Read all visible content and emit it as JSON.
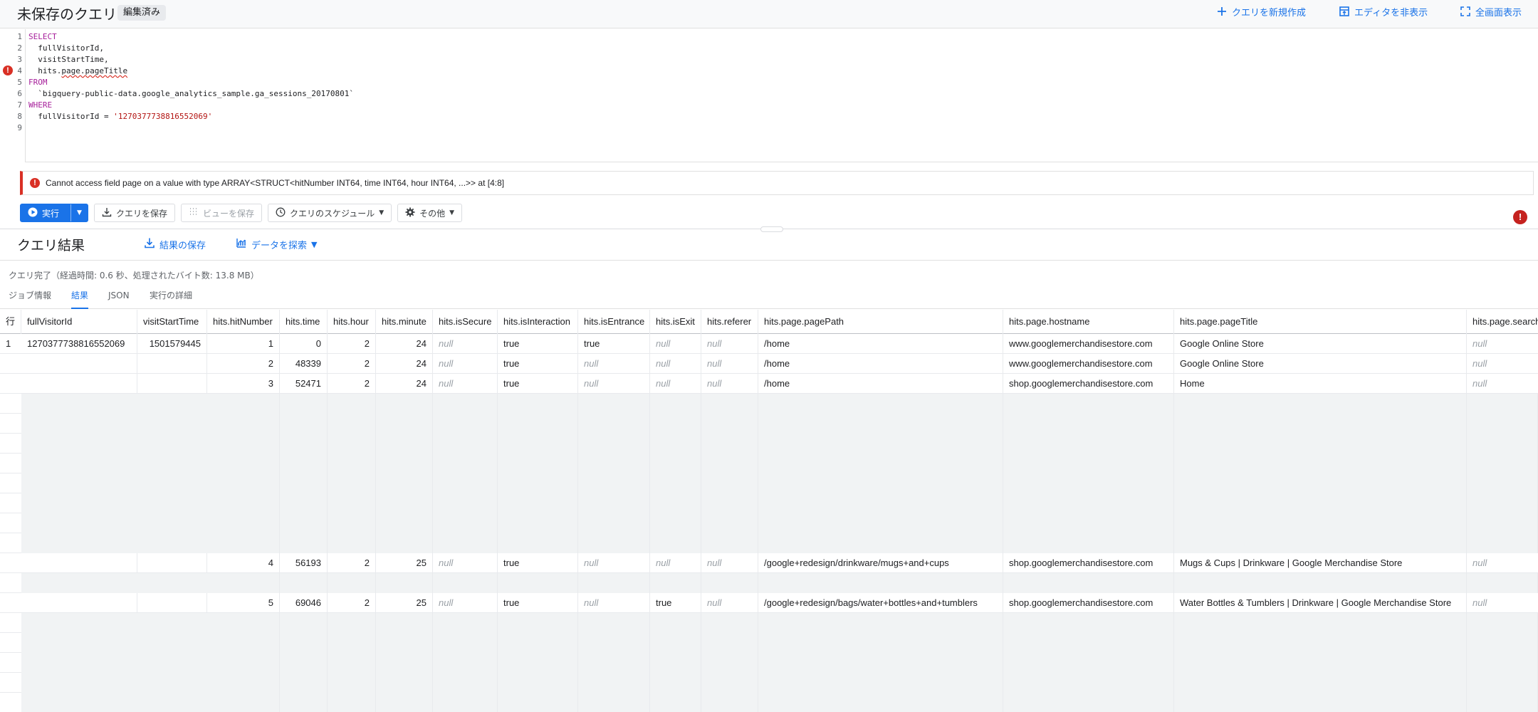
{
  "header": {
    "title": "未保存のクエリ",
    "badge": "編集済み",
    "actions": [
      "クエリを新規作成",
      "エディタを非表示",
      "全画面表示"
    ]
  },
  "editor": {
    "line_numbers": [
      "1",
      "2",
      "3",
      "4",
      "5",
      "6",
      "7",
      "8",
      "9"
    ],
    "lines": [
      {
        "kw": "SELECT",
        "rest": ""
      },
      {
        "kw": "",
        "rest": "  fullVisitorId,"
      },
      {
        "kw": "",
        "rest": "  visitStartTime,"
      },
      {
        "kw": "",
        "pre": "  hits.",
        "squiggle": "page.pageTitle"
      },
      {
        "kw": "FROM",
        "rest": ""
      },
      {
        "kw": "",
        "rest": "  `bigquery-public-data.google_analytics_sample.ga_sessions_20170801`"
      },
      {
        "kw": "WHERE",
        "rest": ""
      },
      {
        "kw": "",
        "pre": "  fullVisitorId = ",
        "str": "'1270377738816552069'"
      },
      {
        "kw": "",
        "rest": ""
      }
    ]
  },
  "error": {
    "message": "Cannot access field page on a value with type ARRAY<STRUCT<hitNumber INT64, time INT64, hour INT64, ...>> at [4:8]"
  },
  "toolbar": {
    "run": "実行",
    "save_query": "クエリを保存",
    "save_view": "ビューを保存",
    "schedule": "クエリのスケジュール",
    "more": "その他"
  },
  "results": {
    "title": "クエリ結果",
    "save_results": "結果の保存",
    "explore": "データを探索",
    "status": "クエリ完了（経過時間: 0.6 秒、処理されたバイト数: 13.8 MB）",
    "tabs": [
      "ジョブ情報",
      "結果",
      "JSON",
      "実行の詳細"
    ],
    "active_tab": "結果"
  },
  "table": {
    "columns": [
      "行",
      "fullVisitorId",
      "visitStartTime",
      "hits.hitNumber",
      "hits.time",
      "hits.hour",
      "hits.minute",
      "hits.isSecure",
      "hits.isInteraction",
      "hits.isEntrance",
      "hits.isExit",
      "hits.referer",
      "hits.page.pagePath",
      "hits.page.hostname",
      "hits.page.pageTitle",
      "hits.page.searchKeyword"
    ],
    "rows": [
      {
        "row": "1",
        "fullVisitorId": "1270377738816552069",
        "visitStartTime": "1501579445",
        "hitNumber": "1",
        "time": "0",
        "hour": "2",
        "minute": "24",
        "isSecure": "null",
        "isInteraction": "true",
        "isEntrance": "true",
        "isExit": "null",
        "referer": "null",
        "pagePath": "/home",
        "hostname": "www.googlemerchandisestore.com",
        "pageTitle": "Google Online Store",
        "search": "null"
      },
      {
        "row": "",
        "fullVisitorId": "",
        "visitStartTime": "",
        "hitNumber": "2",
        "time": "48339",
        "hour": "2",
        "minute": "24",
        "isSecure": "null",
        "isInteraction": "true",
        "isEntrance": "null",
        "isExit": "null",
        "referer": "null",
        "pagePath": "/home",
        "hostname": "www.googlemerchandisestore.com",
        "pageTitle": "Google Online Store",
        "search": "null"
      },
      {
        "row": "",
        "fullVisitorId": "",
        "visitStartTime": "",
        "hitNumber": "3",
        "time": "52471",
        "hour": "2",
        "minute": "24",
        "isSecure": "null",
        "isInteraction": "true",
        "isEntrance": "null",
        "isExit": "null",
        "referer": "null",
        "pagePath": "/home",
        "hostname": "shop.googlemerchandisestore.com",
        "pageTitle": "Home",
        "search": "null"
      },
      {
        "row": "",
        "fullVisitorId": "",
        "visitStartTime": "",
        "hitNumber": "4",
        "time": "56193",
        "hour": "2",
        "minute": "25",
        "isSecure": "null",
        "isInteraction": "true",
        "isEntrance": "null",
        "isExit": "null",
        "referer": "null",
        "pagePath": "/google+redesign/drinkware/mugs+and+cups",
        "hostname": "shop.googlemerchandisestore.com",
        "pageTitle": "Mugs & Cups | Drinkware | Google Merchandise Store",
        "search": "null"
      },
      {
        "row": "",
        "fullVisitorId": "",
        "visitStartTime": "",
        "hitNumber": "5",
        "time": "69046",
        "hour": "2",
        "minute": "25",
        "isSecure": "null",
        "isInteraction": "true",
        "isEntrance": "null",
        "isExit": "true",
        "referer": "null",
        "pagePath": "/google+redesign/bags/water+bottles+and+tumblers",
        "hostname": "shop.googlemerchandisestore.com",
        "pageTitle": "Water Bottles & Tumblers | Drinkware | Google Merchandise Store",
        "search": "null"
      }
    ]
  },
  "colors": {
    "accent": "#1a73e8",
    "error": "#d93025",
    "null_text": "#9aa0a6",
    "empty_row": "#f1f3f4"
  },
  "icons": [
    "add-icon",
    "hide-editor-icon",
    "fullscreen-icon",
    "play-icon",
    "download-icon",
    "view-icon",
    "clock-icon",
    "gear-icon",
    "error-icon",
    "explore-chart-icon"
  ]
}
